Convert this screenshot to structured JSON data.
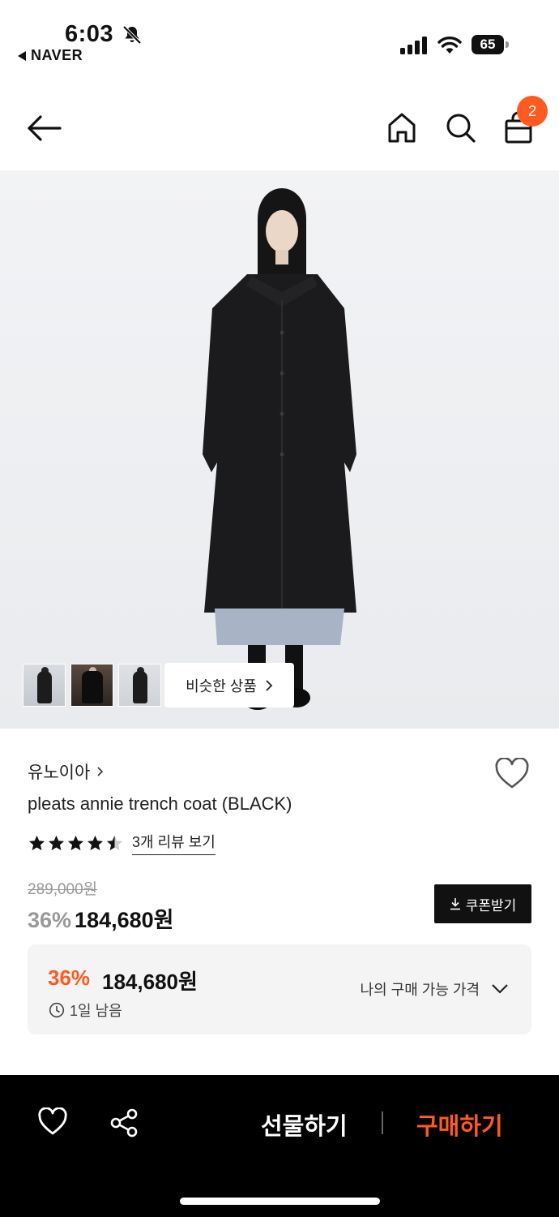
{
  "status_bar": {
    "time": "6:03",
    "back_app": "NAVER",
    "battery": "65"
  },
  "nav": {
    "cart_badge": "2"
  },
  "product": {
    "similar_label": "비슷한 상품",
    "brand": "유노이아",
    "name": "pleats annie trench coat (BLACK)",
    "rating": 4.5,
    "review_link": "3개 리뷰 보기",
    "original_price": "289,000원",
    "discount": "36%",
    "price": "184,680원",
    "coupon_label": "쿠폰받기"
  },
  "benefit": {
    "discount": "36%",
    "price": "184,680원",
    "remaining": "1일 남음",
    "my_price_label": "나의 구매 가능 가격"
  },
  "bottom": {
    "gift_label": "선물하기",
    "buy_label": "구매하기"
  },
  "colors": {
    "accent": "#ff5a1f",
    "bottom_bar": "#000000"
  }
}
